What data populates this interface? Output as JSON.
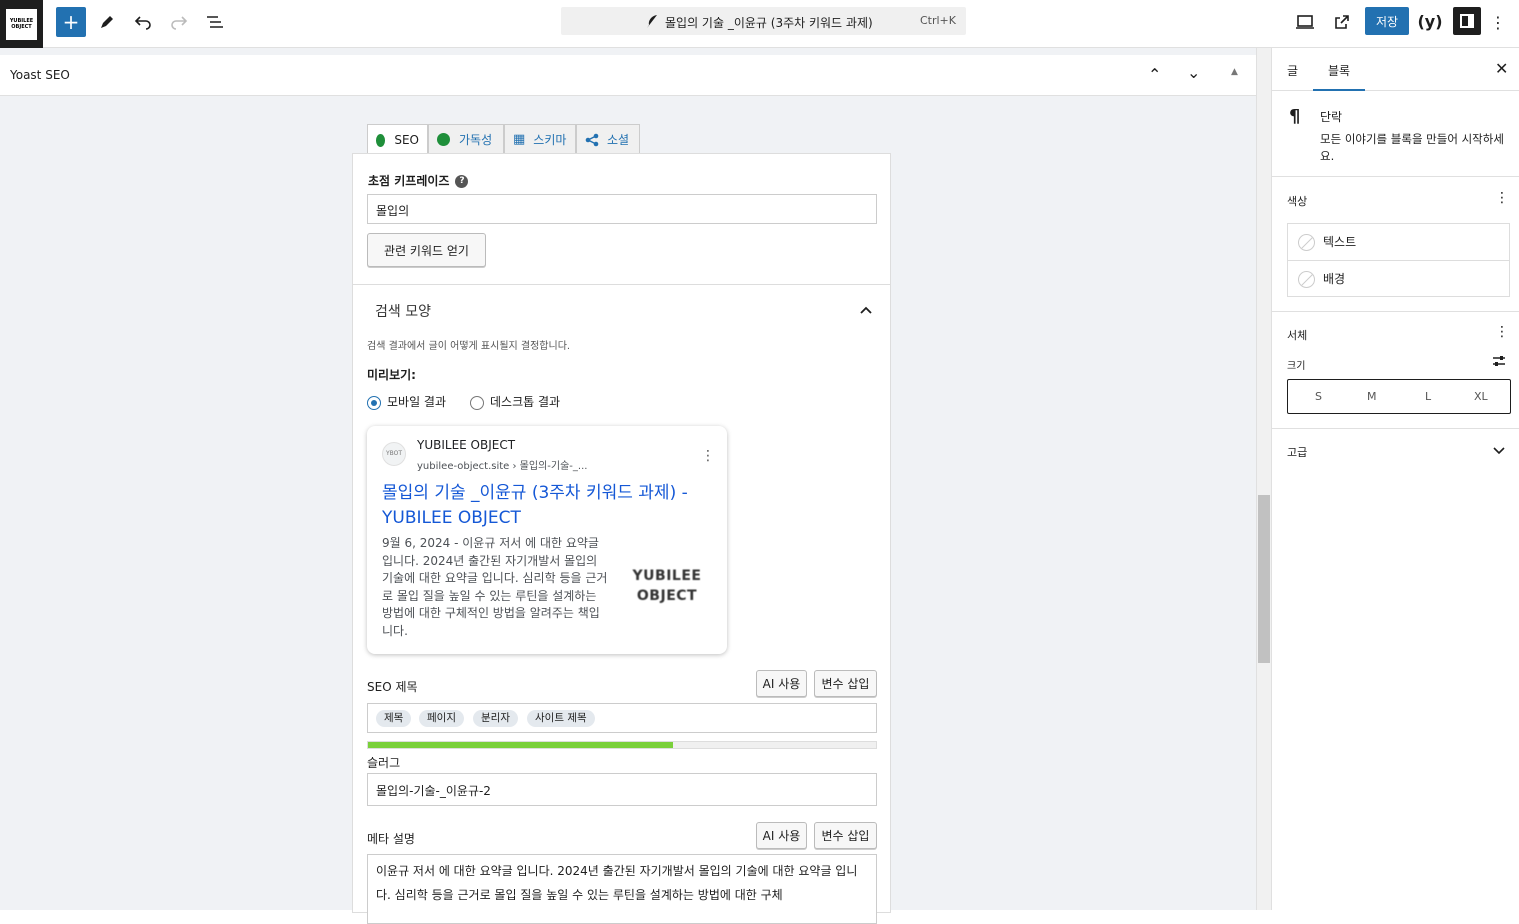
{
  "topbar": {
    "logo_text": "YUBILEE OBJECT",
    "doc_title": "몰입의 기술 _이윤규 (3주차 키워드 과제)",
    "shortcut": "Ctrl+K",
    "save_label": "저장"
  },
  "yoast_header": {
    "label": "Yoast SEO"
  },
  "tabs": [
    {
      "label": "SEO"
    },
    {
      "label": "가독성"
    },
    {
      "label": "스키마"
    },
    {
      "label": "소셜"
    }
  ],
  "seo": {
    "focus_label": "초점 키프레이즈",
    "focus_value": "몰입의",
    "related_btn": "관련 키워드 얻기",
    "search_appearance": "검색 모양",
    "search_desc": "검색 결과에서 글이 어떻게 표시될지 결정합니다.",
    "preview_label": "미리보기:",
    "mobile_label": "모바일 결과",
    "desktop_label": "데스크톱 결과",
    "snippet": {
      "icon_text": "YBOT",
      "site_name": "YUBILEE OBJECT",
      "site_url": "yubilee-object.site › 몰입의-기술-_...",
      "title": "몰입의 기술 _이윤규 (3주차 키워드 과제) - YUBILEE OBJECT",
      "date": "9월 6, 2024",
      "desc": "이윤규 저서 에 대한 요약글 입니다. 2024년 출간된 자기개발서 몰입의 기술에 대한 요약글 입니다. 심리학 등을 근거로 몰입 질을 높일 수 있는 루틴을 설계하는 방법에 대한 구체적인 방법을 알려주는 책입니다.",
      "thumb_line1": "YUBILEE",
      "thumb_line2": "OBJECT"
    },
    "seo_title_label": "SEO 제목",
    "ai_btn": "AI 사용",
    "var_btn": "변수 삽입",
    "pills": [
      "제목",
      "페이지",
      "분리자",
      "사이트 제목"
    ],
    "title_progress": 0.6,
    "slug_label": "슬러그",
    "slug_value": "몰입의-기술-_이윤규-2",
    "meta_label": "메타 설명",
    "meta_value": "이윤규 저서 에 대한 요약글 입니다. 2024년 출간된 자기개발서 몰입의 기술에 대한 요약글 입니다. 심리학 등을 근거로 몰입 질을 높일 수 있는 루틴을 설계하는 방법에 대한 구체"
  },
  "sidebar": {
    "tab_post": "글",
    "tab_block": "블록",
    "block_name": "단락",
    "block_desc": "모든 이야기를 블록을 만들어 시작하세요.",
    "color_label": "색상",
    "text_color": "텍스트",
    "bg_color": "배경",
    "typo_label": "서체",
    "size_label": "크기",
    "sizes": [
      "S",
      "M",
      "L",
      "XL"
    ],
    "advanced_label": "고급"
  },
  "colors": {
    "accent": "#2271b1",
    "good": "#7ad03a",
    "smile": "#1f8f3a"
  }
}
